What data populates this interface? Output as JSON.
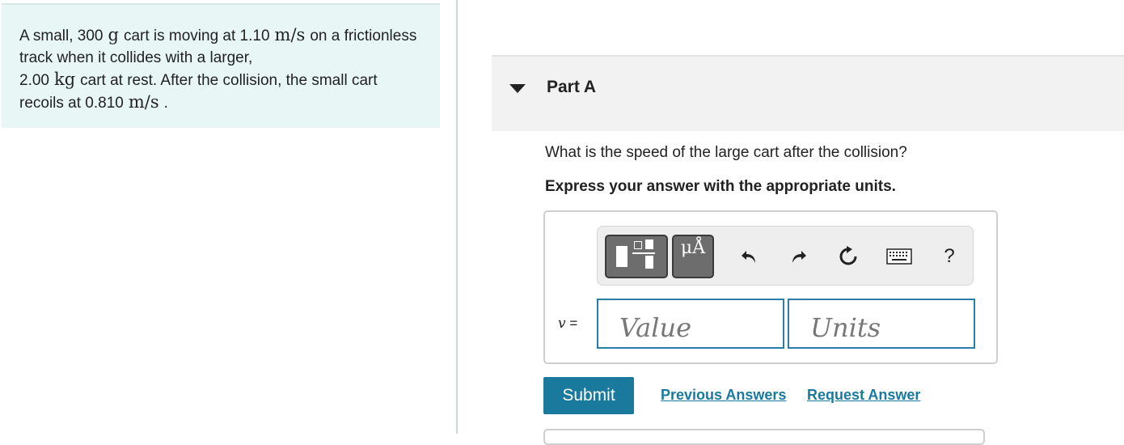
{
  "problem": {
    "segments": [
      {
        "t": "A small, 300",
        "m": false
      },
      {
        "t": "g",
        "m": true
      },
      {
        "t": "cart is moving at 1.10",
        "m": false
      },
      {
        "t": "m/s",
        "m": true
      },
      {
        "t": "on a frictionless track when it collides with a larger,",
        "m": false
      },
      {
        "t": "2.00",
        "m": false
      },
      {
        "t": "kg",
        "m": true
      },
      {
        "t": "cart at rest. After the collision, the small cart recoils at 0.810",
        "m": false
      },
      {
        "t": "m/s",
        "m": true
      },
      {
        "t": ".",
        "m": false
      }
    ]
  },
  "part": {
    "title": "Part A",
    "question": "What is the speed of the large cart after the collision?",
    "instruction": "Express your answer with the appropriate units."
  },
  "toolbar": {
    "units_glyph": "μÅ",
    "help_label": "?",
    "icons": [
      "templates-icon",
      "units-icon",
      "undo-icon",
      "redo-icon",
      "reset-icon",
      "keyboard-icon",
      "help-icon"
    ]
  },
  "answer": {
    "variable": "v",
    "equals": "=",
    "value_placeholder": "Value",
    "units_placeholder": "Units"
  },
  "actions": {
    "submit_label": "Submit",
    "previous_answers_label": "Previous Answers",
    "request_answer_label": "Request Answer"
  },
  "colors": {
    "problem_bg": "#e8f6f6",
    "accent": "#1a7a9e",
    "input_border": "#2a7fa7"
  }
}
